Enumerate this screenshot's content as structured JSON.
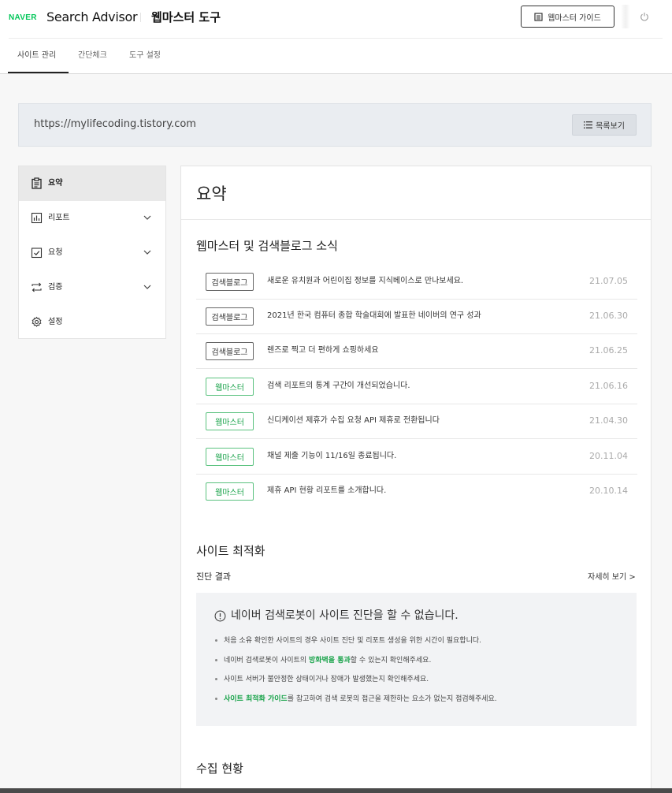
{
  "header": {
    "logo": "NAVER",
    "brand": "Search Advisor",
    "subtitle": "웹마스터 도구",
    "guide_label": "웹마스터 가이드"
  },
  "tabs": [
    {
      "label": "사이트 관리",
      "active": true
    },
    {
      "label": "간단체크",
      "active": false
    },
    {
      "label": "도구 설정",
      "active": false
    }
  ],
  "site": {
    "url": "https://mylifecoding.tistory.com",
    "list_label": "목록보기"
  },
  "sidebar": {
    "items": [
      {
        "label": "요약",
        "icon": "clipboard-icon",
        "active": true
      },
      {
        "label": "리포트",
        "icon": "bar-chart-icon",
        "expandable": true
      },
      {
        "label": "요청",
        "icon": "checkbox-icon",
        "expandable": true
      },
      {
        "label": "검증",
        "icon": "transfer-arrows-icon",
        "expandable": true
      },
      {
        "label": "설정",
        "icon": "gear-icon"
      }
    ]
  },
  "main": {
    "title": "요약",
    "news_title": "웹마스터 및 검색블로그 소식",
    "news": [
      {
        "category": "검색블로그",
        "type": "blog",
        "text": "새로운 유치원과 어린이집 정보를 지식베이스로 만나보세요.",
        "date": "21.07.05"
      },
      {
        "category": "검색블로그",
        "type": "blog",
        "text": "2021년 한국 컴퓨터 종합 학술대회에 발표한 네이버의 연구 성과",
        "date": "21.06.30"
      },
      {
        "category": "검색블로그",
        "type": "blog",
        "text": "렌즈로 찍고 더 편하게 쇼핑하세요",
        "date": "21.06.25"
      },
      {
        "category": "웹마스터",
        "type": "webmaster",
        "text": "검색 리포트의 통계 구간이 개선되었습니다.",
        "date": "21.06.16"
      },
      {
        "category": "웹마스터",
        "type": "webmaster",
        "text": "신디케이션 제휴가 수집 요청 API 제휴로 전환됩니다",
        "date": "21.04.30"
      },
      {
        "category": "웹마스터",
        "type": "webmaster",
        "text": "채널 제출 기능이 11/16일 종료됩니다.",
        "date": "20.11.04"
      },
      {
        "category": "웹마스터",
        "type": "webmaster",
        "text": "제휴 API 현황 리포트를 소개합니다.",
        "date": "20.10.14"
      }
    ],
    "optimization": {
      "title": "사이트 최적화",
      "diag_label": "진단 결과",
      "more_label": "자세히 보기 >",
      "notice_title": "네이버 검색로봇이 사이트 진단을 할 수 없습니다.",
      "bullets": {
        "b1": "처음 소유 확인한 사이트의 경우 사이트 진단 및 리포트 생성을 위한 시간이 필요합니다.",
        "b2_pre": "네이버 검색로봇이 사이트의 ",
        "b2_hl": "방화벽을 통과",
        "b2_post": "할 수 있는지 확인해주세요.",
        "b3": "사이트 서버가 불안정한 상태이거나 장애가 발생했는지 확인해주세요.",
        "b4_hl": "사이트 최적화 가이드",
        "b4_post": "를 참고하여 검색 로봇의 접근을 제한하는 요소가 없는지 점검해주세요."
      }
    },
    "collection_title": "수집 현황"
  },
  "colors": {
    "naver_green": "#03c75a",
    "accent_green": "#19a34a",
    "badge_green_border": "#5bc27f"
  }
}
